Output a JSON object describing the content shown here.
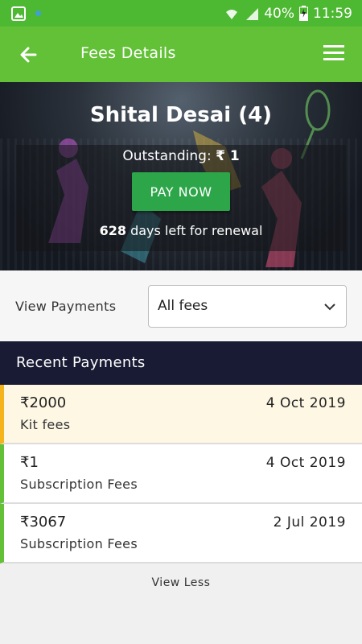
{
  "status_bar": {
    "battery": "40%",
    "time": "11:59"
  },
  "app_bar": {
    "title": "Fees Details"
  },
  "hero": {
    "name": "Shital Desai (4)",
    "outstanding_label": "Outstanding:",
    "outstanding_amount": "₹ 1",
    "pay_button": "PAY NOW",
    "days_left": "628",
    "renewal_text": " days left for renewal"
  },
  "filter": {
    "label": "View Payments",
    "selected": "All fees"
  },
  "recent": {
    "title": "Recent Payments",
    "payments": [
      {
        "amount": "₹2000",
        "date": "4 Oct 2019",
        "description": "Kit fees"
      },
      {
        "amount": "₹1",
        "date": "4 Oct 2019",
        "description": "Subscription Fees"
      },
      {
        "amount": "₹3067",
        "date": "2 Jul 2019",
        "description": "Subscription Fees"
      }
    ]
  },
  "footer": {
    "view_less": "View Less"
  },
  "colors": {
    "app_bar": "#62c137",
    "status_bar": "#4db832",
    "pay_button": "#2da64a",
    "header_dark": "#181b33",
    "highlight_accent": "#f5b41c"
  }
}
